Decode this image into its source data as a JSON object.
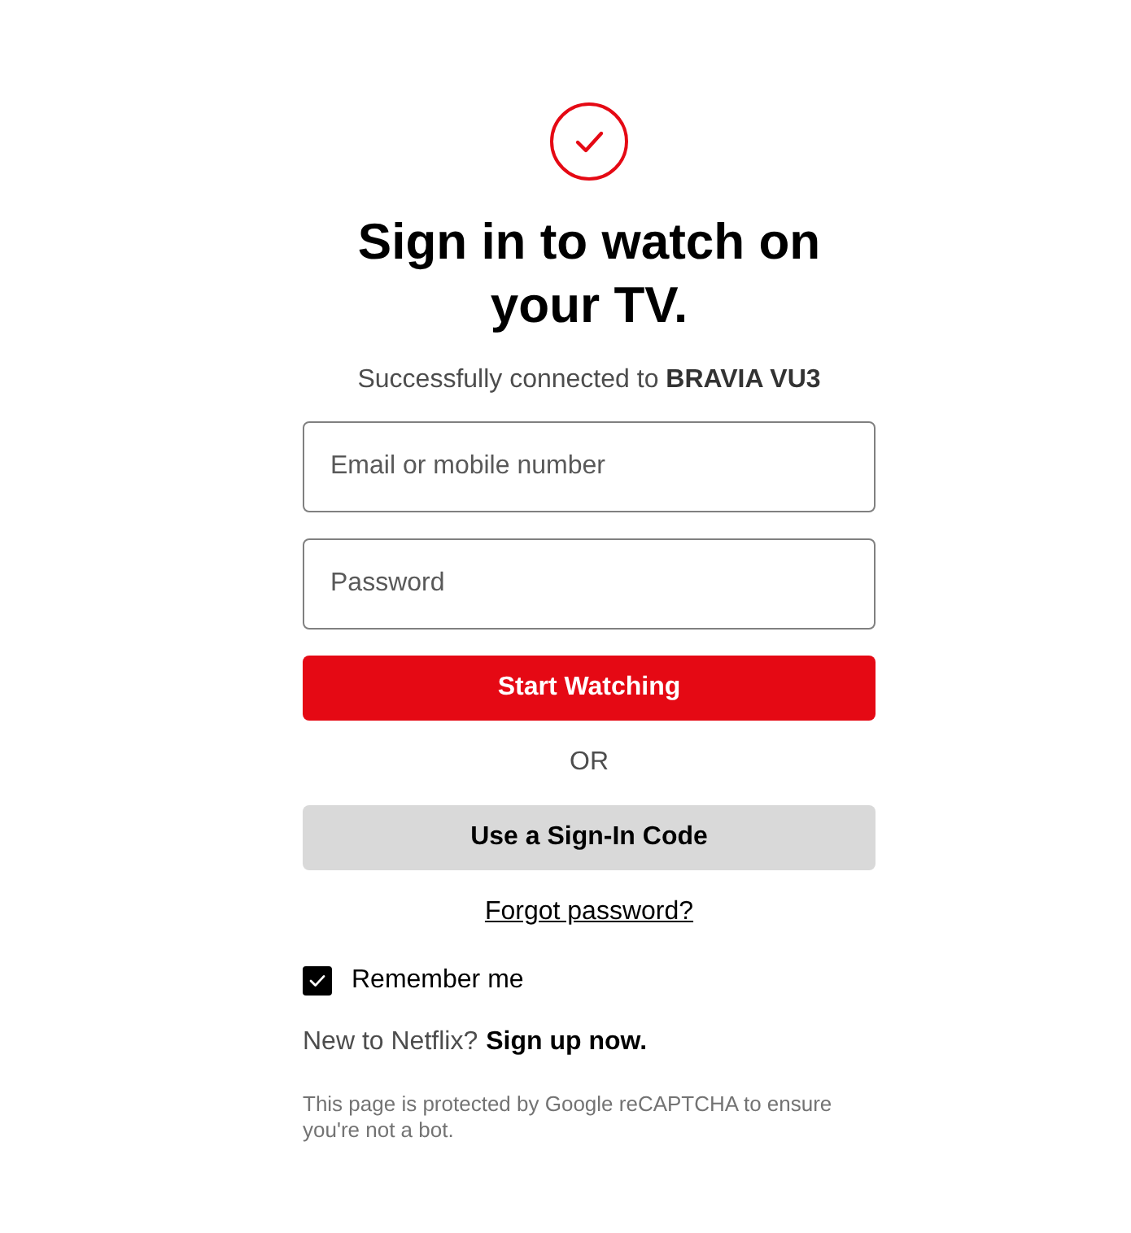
{
  "heading": "Sign in to watch on your TV.",
  "connection_message": "Successfully connected to **BRAVIA VU3**",
  "email_field": {
    "placeholder": "Email or mobile number"
  },
  "password_field": {
    "placeholder": "Password"
  },
  "primary_button": {
    "label": "Start Watching"
  },
  "divider_text": "OR",
  "secondary_button": {
    "label": "Use a Sign-In Code"
  },
  "forgot_password_link": "Forgot password?",
  "remember_me": {
    "label": "Remember me",
    "checked": true
  },
  "signup": {
    "prompt": "New to Netflix?",
    "link": "Sign up now."
  },
  "recaptcha_notice": "This page is protected by Google reCAPTCHA to ensure you're not a bot."
}
